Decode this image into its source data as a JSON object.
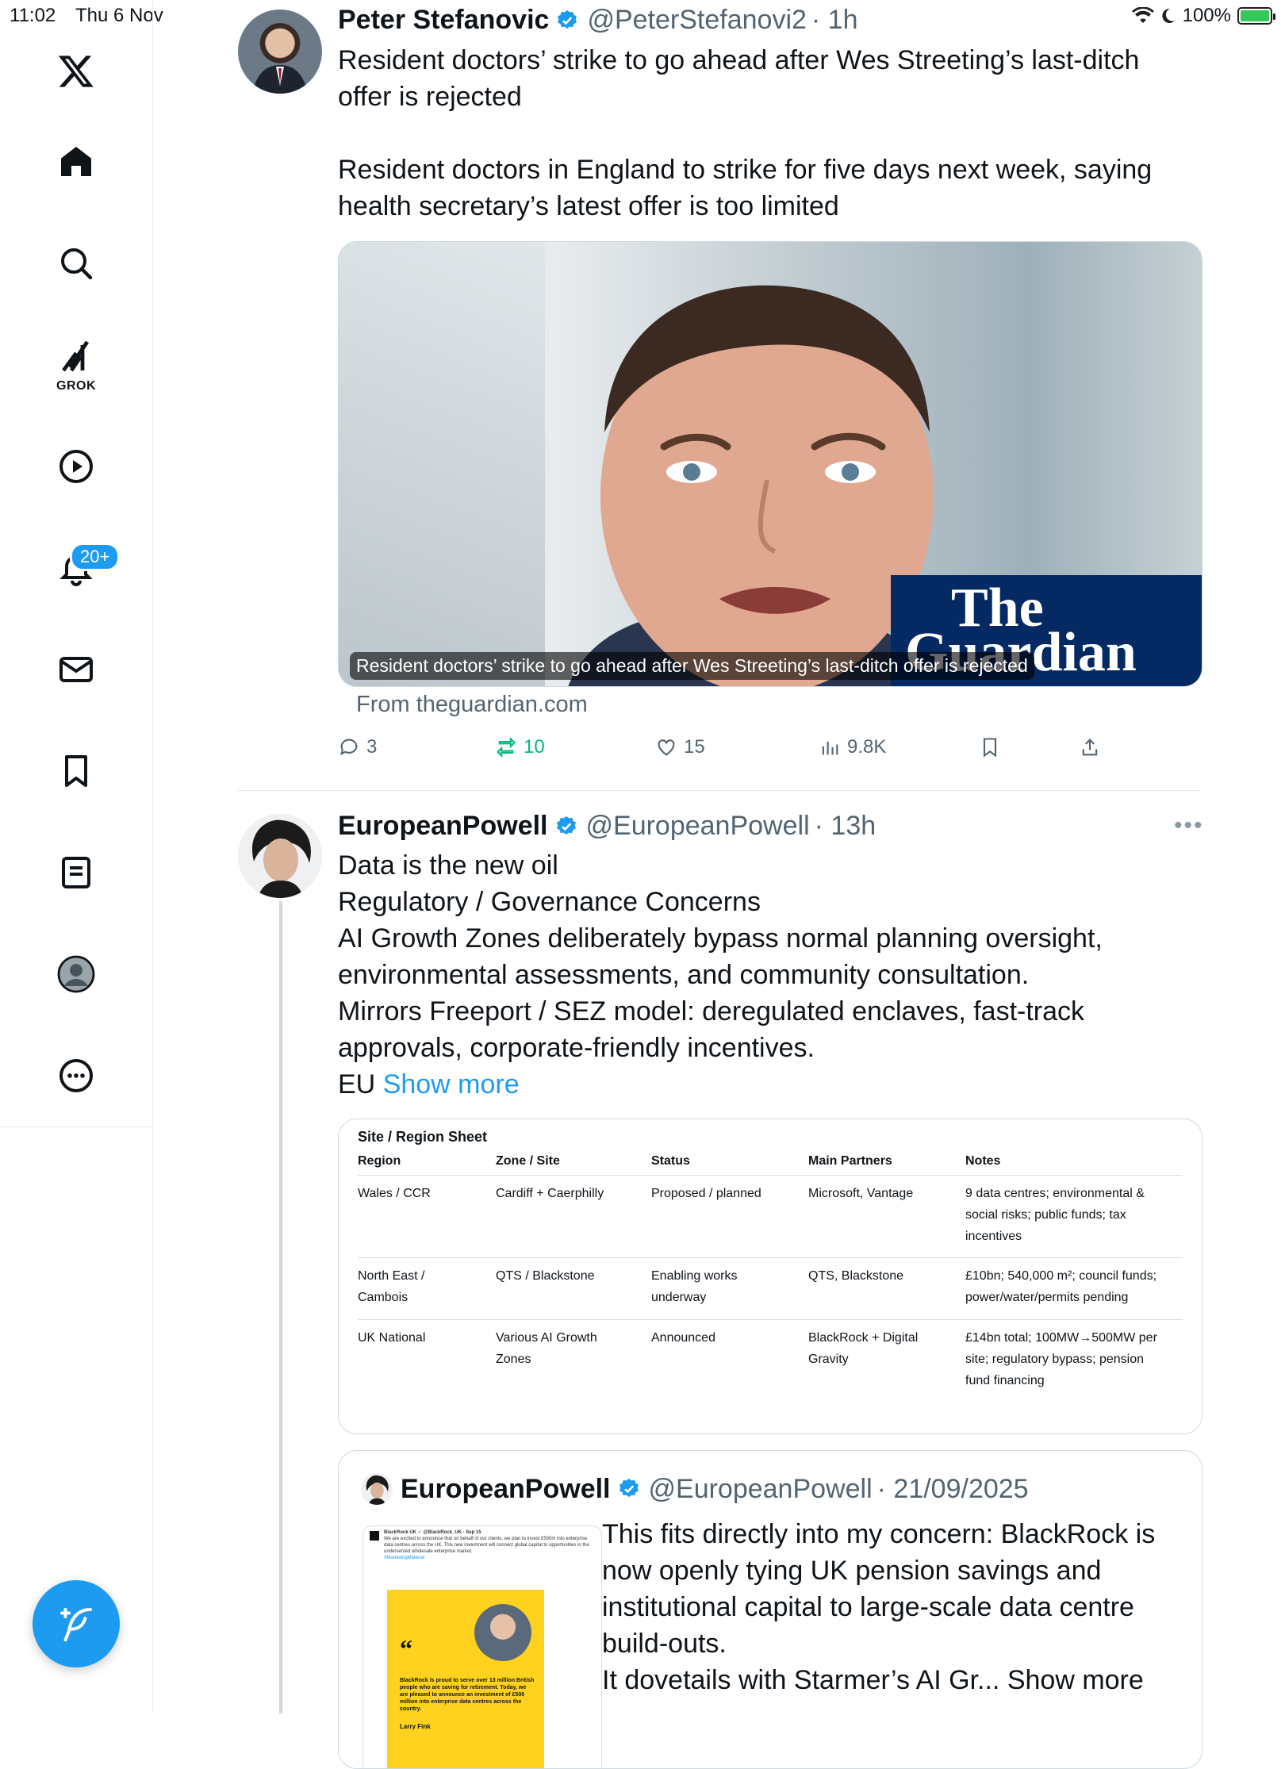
{
  "status_bar": {
    "time": "11:02",
    "date": "Thu 6 Nov",
    "battery": "100%"
  },
  "sidebar": {
    "grok_label": "GROK",
    "notifications_badge": "20+"
  },
  "tweet1": {
    "name": "Peter Stefanovic",
    "handle": "@PeterStefanovi2",
    "time": "· 1h",
    "text_line1": "Resident doctors’ strike to go ahead after Wes Streeting’s last-ditch",
    "text_line2": "offer is rejected",
    "text_line3": "Resident doctors in England to strike for five days next week, saying",
    "text_line4": "health secretary’s latest offer is too limited",
    "card_caption": "Resident doctors’ strike to go ahead after Wes Streeting’s last-ditch offer is rejected",
    "card_logo_line1": "The",
    "card_logo_line2": "Guardian",
    "card_source": "From theguardian.com",
    "replies": "3",
    "reposts": "10",
    "likes": "15",
    "views": "9.8K"
  },
  "tweet2": {
    "name": "EuropeanPowell",
    "handle": "@EuropeanPowell",
    "time": "· 13h",
    "lines": [
      "Data is the new oil",
      "Regulatory / Governance Concerns",
      "AI Growth Zones deliberately bypass normal planning oversight,",
      "environmental assessments, and community consultation.",
      "Mirrors Freeport / SEZ model: deregulated enclaves, fast-track",
      "approvals, corporate-friendly incentives."
    ],
    "last_line_prefix": "EU",
    "show_more": "Show more",
    "table": {
      "title": "Site / Region Sheet",
      "headers": [
        "Region",
        "Zone / Site",
        "Status",
        "Main Partners",
        "Notes"
      ],
      "rows": [
        {
          "region": [
            "Wales / CCR"
          ],
          "zone": [
            "Cardiff + Caerphilly"
          ],
          "status": [
            "Proposed / planned"
          ],
          "partners": [
            "Microsoft, Vantage"
          ],
          "notes": [
            "9 data centres; environmental &",
            "social risks; public funds; tax",
            "incentives"
          ]
        },
        {
          "region": [
            "North East /",
            "Cambois"
          ],
          "zone": [
            "QTS / Blackstone"
          ],
          "status": [
            "Enabling works",
            "underway"
          ],
          "partners": [
            "QTS, Blackstone"
          ],
          "notes": [
            "£10bn; 540,000 m²; council funds;",
            "power/water/permits pending"
          ]
        },
        {
          "region": [
            "UK National"
          ],
          "zone": [
            "Various AI Growth",
            "Zones"
          ],
          "status": [
            "Announced"
          ],
          "partners": [
            "BlackRock + Digital",
            "Gravity"
          ],
          "notes": [
            "£14bn total; 100MW→500MW per",
            "site; regulatory bypass; pension",
            "fund financing"
          ]
        }
      ]
    },
    "quote": {
      "name": "EuropeanPowell",
      "handle": "@EuropeanPowell",
      "date": "· 21/09/2025",
      "lines": [
        "This fits directly into my concern: BlackRock is",
        "now openly tying UK pension savings and",
        "institutional capital to large-scale data centre",
        "build-outs."
      ],
      "last_line": "It dovetails with Starmer’s AI Gr...",
      "show_more": "Show more",
      "thumb_quote_mark": "“",
      "thumb_text_top": "BlackRock UK ✓ @BlackRock_UK · Sep 15",
      "thumb_text_body": "We are excited to announce that on behalf of our clients, we plan to invest £500m into enterprise data centres across the UK. This new investment will connect global capital to opportunities in the underserved wholesale enterprise market.",
      "thumb_text_hashtag": "#MarketingMaterial",
      "thumb_text_quote": "BlackRock is proud to serve over 13 million British people who are saving for retirement. Today, we are pleased to announce an investment of £500 million into enterprise data centres across the country.",
      "thumb_text_author": "Larry Fink"
    }
  },
  "colors": {
    "accent": "#1d9bf0",
    "repost": "#00ba7c",
    "guardian_blue": "#052962",
    "muted": "#536471"
  }
}
